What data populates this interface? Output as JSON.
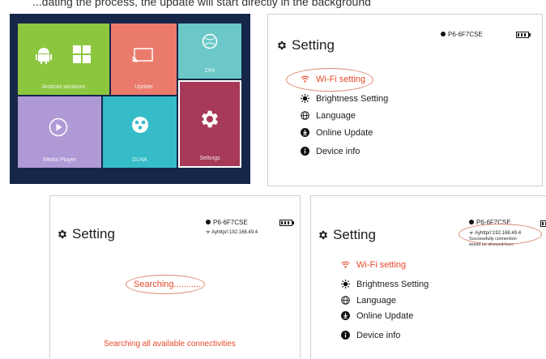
{
  "caption": "...dating the process, the update will start directly in the background",
  "launcher": {
    "tiles": [
      {
        "label": "Android  windows"
      },
      {
        "label": "Update"
      },
      {
        "label": "DIN"
      },
      {
        "label": "Media Player"
      },
      {
        "label": "DLNA"
      },
      {
        "label": "Settings"
      }
    ]
  },
  "colors": {
    "accent": "#e8482a",
    "tile_green": "#8cc63f",
    "tile_salmon": "#ea7b6c",
    "tile_teal": "#6cc8c8",
    "tile_purple": "#b09ad6",
    "tile_cyan": "#35bcc8",
    "tile_maroon": "#a63a58"
  },
  "panel_main": {
    "title": "Setting",
    "device": "P6-6F7CSE",
    "menu": [
      {
        "label": "Wi-Fi setting",
        "icon": "wifi-icon"
      },
      {
        "label": "Brightness Setting",
        "icon": "brightness-icon"
      },
      {
        "label": "Language",
        "icon": "globe-icon"
      },
      {
        "label": "Online Update",
        "icon": "download-icon"
      },
      {
        "label": "Device info",
        "icon": "info-icon"
      }
    ]
  },
  "panel_search": {
    "title": "Setting",
    "device": "P6-6F7CSE",
    "ssid": "Ayhttp//:192.168.49.4",
    "searching": "Searching...........",
    "note": "Searching all available connectivities"
  },
  "panel_connected": {
    "title": "Setting",
    "device": "P6-6F7CSE",
    "ssid": "Ayhttp//:192.168.49.4",
    "hint_line1": "Successfully connection",
    "hint_line2": "would be showed here",
    "menu": [
      {
        "label": "Wi-Fi setting",
        "icon": "wifi-icon"
      },
      {
        "label": "Brightness Setting",
        "icon": "brightness-icon"
      },
      {
        "label": "Language",
        "icon": "globe-icon"
      },
      {
        "label": "Online Update",
        "icon": "download-icon"
      },
      {
        "label": "Device info",
        "icon": "info-icon"
      }
    ]
  }
}
